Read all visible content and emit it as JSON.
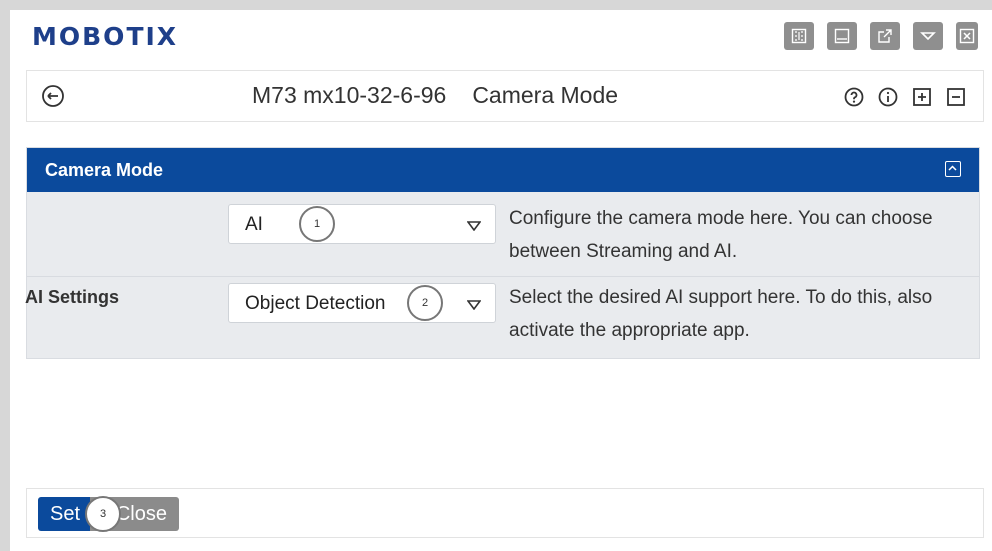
{
  "app": {
    "logo_text": "MOBOTIX"
  },
  "toolbar": {
    "icons": [
      "grid-view-icon",
      "panel-icon",
      "external-link-icon",
      "dropdown-icon",
      "close-window-icon"
    ]
  },
  "header": {
    "camera_name": "M73 mx10-32-6-96",
    "page_title": "Camera Mode",
    "icons": [
      "help-icon",
      "info-icon",
      "expand-all-icon",
      "collapse-all-icon"
    ]
  },
  "panel": {
    "title": "Camera Mode",
    "rows": [
      {
        "label": "",
        "select_value": "AI",
        "callout": "1",
        "description": "Configure the camera mode here. You can choose between Streaming and AI."
      },
      {
        "label": "AI Settings",
        "select_value": "Object Detection",
        "callout": "2",
        "description": "Select the desired AI support here. To do this, also activate the appropriate app."
      }
    ]
  },
  "footer": {
    "set_label": "Set",
    "close_label": "Close",
    "callout": "3"
  },
  "colors": {
    "brand_blue": "#0b4a9c",
    "logo_blue": "#1e3f8a",
    "icon_gray": "#8f8f8f",
    "panel_bg": "#e9ebee"
  }
}
